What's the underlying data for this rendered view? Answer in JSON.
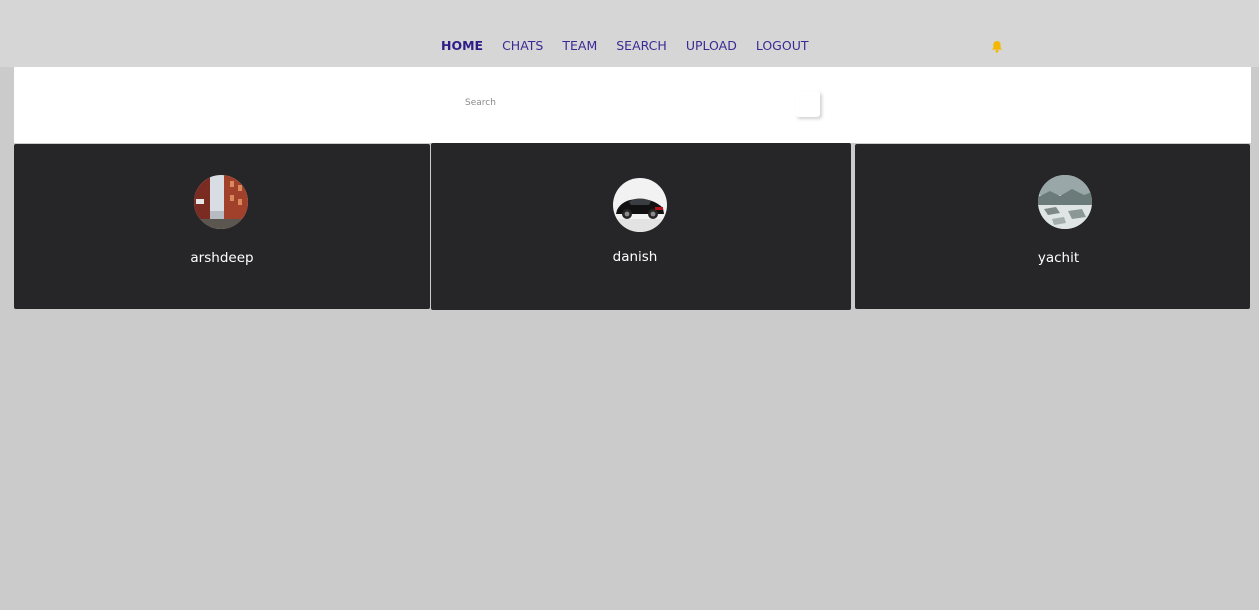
{
  "nav": {
    "items": [
      {
        "label": "HOME",
        "active": true
      },
      {
        "label": "CHATS",
        "active": false
      },
      {
        "label": "TEAM",
        "active": false
      },
      {
        "label": "SEARCH",
        "active": false
      },
      {
        "label": "UPLOAD",
        "active": false
      },
      {
        "label": "LOGOUT",
        "active": false
      }
    ],
    "notification_icon": "bell-icon",
    "notification_color": "#f5b800"
  },
  "search": {
    "placeholder": "Search",
    "value": ""
  },
  "users": [
    {
      "name": "arshdeep",
      "avatar": "street-photo-avatar"
    },
    {
      "name": "danish",
      "avatar": "black-car-avatar"
    },
    {
      "name": "yachit",
      "avatar": "snowy-landscape-avatar"
    }
  ],
  "colors": {
    "nav_link": "#3b2a94",
    "card_background": "#262628",
    "page_background": "#cbcbcb"
  }
}
